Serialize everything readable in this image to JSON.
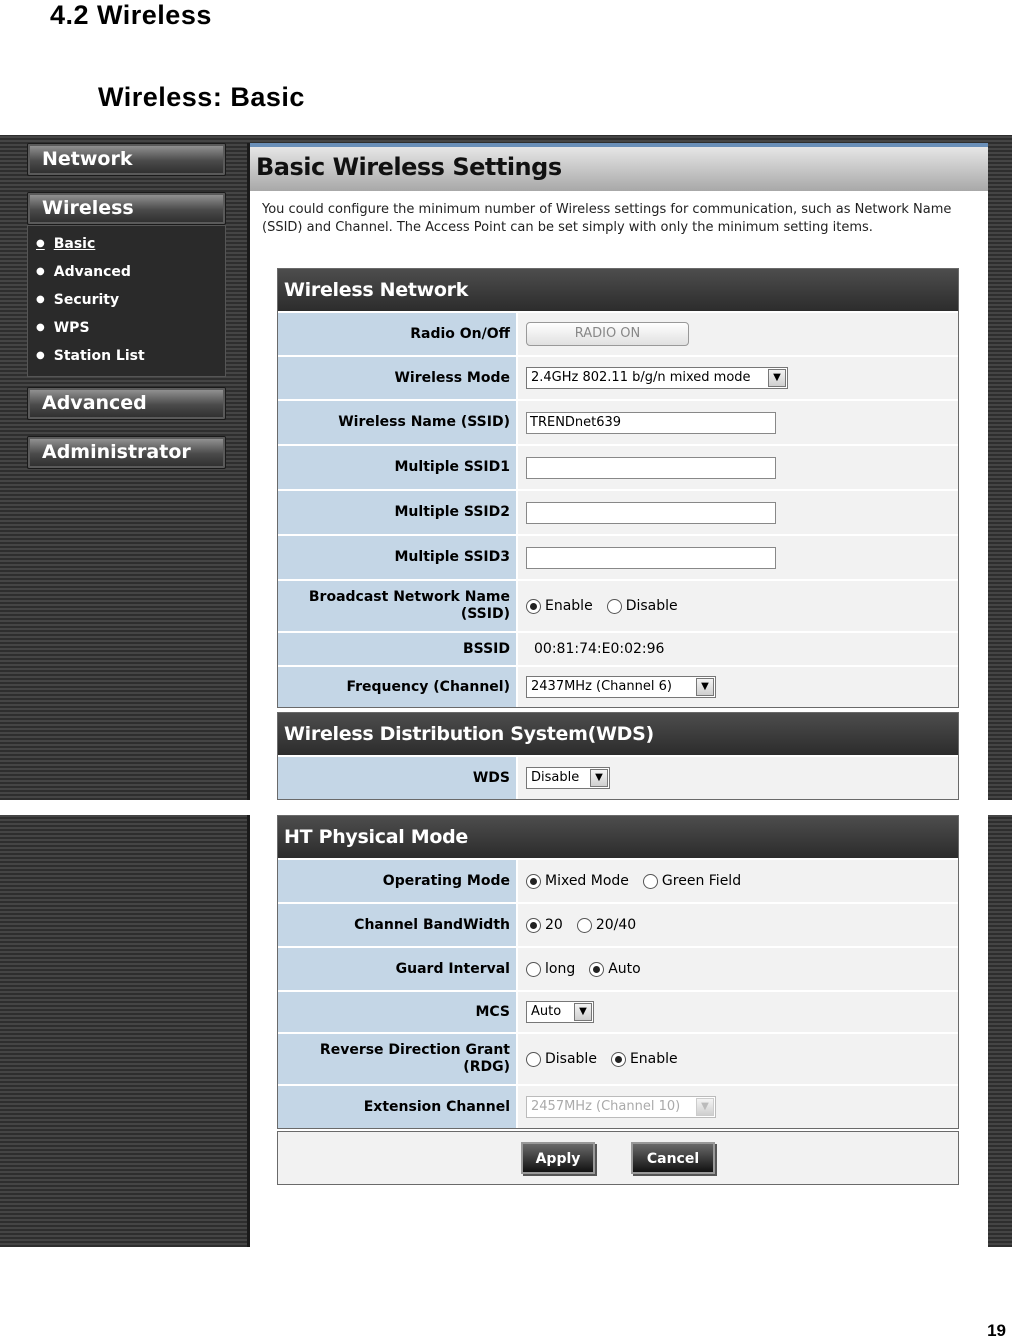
{
  "doc": {
    "section_title": "4.2 Wireless",
    "subsection_title": "Wireless: Basic",
    "page_number": "19"
  },
  "nav": {
    "network": "Network",
    "wireless": "Wireless",
    "sub_items": [
      "Basic",
      "Advanced",
      "Security",
      "WPS",
      "Station List"
    ],
    "advanced": "Advanced",
    "administrator": "Administrator"
  },
  "page": {
    "title": "Basic Wireless Settings",
    "intro": "You could configure the minimum number of Wireless settings for communication, such as Network Name (SSID) and Channel. The Access Point can be set simply with only the minimum setting items."
  },
  "wireless_network": {
    "heading": "Wireless Network",
    "radio_label": "Radio On/Off",
    "radio_button": "RADIO ON",
    "mode_label": "Wireless Mode",
    "mode_value": "2.4GHz 802.11 b/g/n mixed mode",
    "ssid_label": "Wireless Name (SSID)",
    "ssid_value": "TRENDnet639",
    "mssid1_label": "Multiple SSID1",
    "mssid2_label": "Multiple SSID2",
    "mssid3_label": "Multiple SSID3",
    "broadcast_label_1": "Broadcast Network Name",
    "broadcast_label_2": "(SSID)",
    "enable": "Enable",
    "disable": "Disable",
    "bssid_label": "BSSID",
    "bssid_value": "00:81:74:E0:02:96",
    "freq_label": "Frequency (Channel)",
    "freq_value": "2437MHz (Channel 6)"
  },
  "wds": {
    "heading": "Wireless Distribution System(WDS)",
    "label": "WDS",
    "value": "Disable"
  },
  "ht": {
    "heading": "HT Physical Mode",
    "opmode_label": "Operating Mode",
    "mixed_mode": "Mixed Mode",
    "green_field": "Green Field",
    "bw_label": "Channel BandWidth",
    "bw_20": "20",
    "bw_2040": "20/40",
    "gi_label": "Guard Interval",
    "gi_long": "long",
    "gi_auto": "Auto",
    "mcs_label": "MCS",
    "mcs_value": "Auto",
    "rdg_label_1": "Reverse Direction Grant",
    "rdg_label_2": "(RDG)",
    "rdg_disable": "Disable",
    "rdg_enable": "Enable",
    "ext_label": "Extension Channel",
    "ext_value": "2457MHz (Channel 10)"
  },
  "buttons": {
    "apply": "Apply",
    "cancel": "Cancel"
  }
}
